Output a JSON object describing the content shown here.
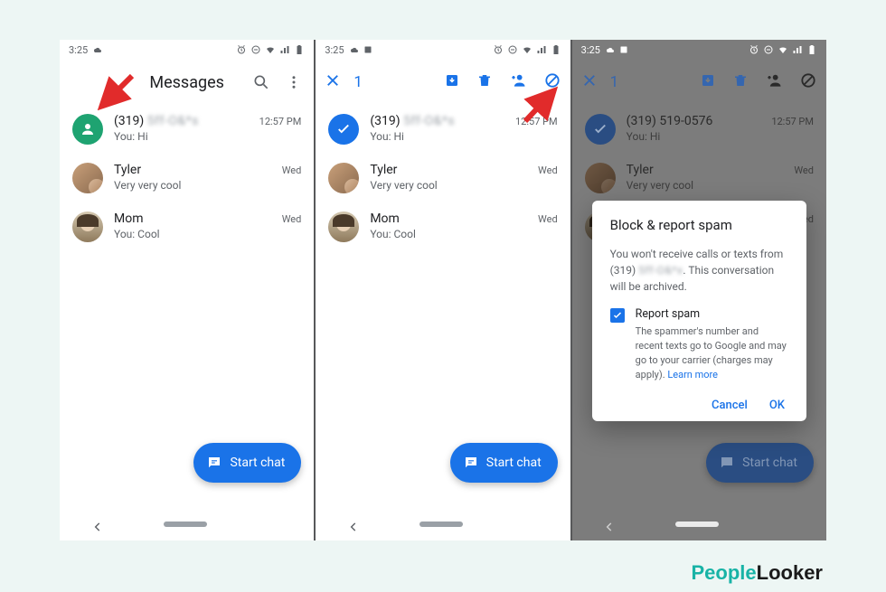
{
  "status": {
    "time": "3:25"
  },
  "screen1": {
    "title": "Messages",
    "conversations": [
      {
        "name_prefix": "(319) ",
        "name_blur": "5ff-O&*s",
        "snippet": "You: Hi",
        "time": "12:57 PM"
      },
      {
        "name": "Tyler",
        "snippet": "Very very cool",
        "time": "Wed"
      },
      {
        "name": "Mom",
        "snippet": "You: Cool",
        "time": "Wed"
      }
    ],
    "fab": "Start chat"
  },
  "screen2": {
    "selected_count": "1",
    "conversations": [
      {
        "name_prefix": "(319) ",
        "name_blur": "5ff-O&*s",
        "snippet": "You: Hi",
        "time": "12:57 PM"
      },
      {
        "name": "Tyler",
        "snippet": "Very very cool",
        "time": "Wed"
      },
      {
        "name": "Mom",
        "snippet": "You: Cool",
        "time": "Wed"
      }
    ],
    "fab": "Start chat"
  },
  "screen3": {
    "selected_count": "1",
    "conversations": [
      {
        "name": "(319) 519-0576",
        "snippet": "You: Hi",
        "time": "12:57 PM"
      },
      {
        "name": "Tyler",
        "snippet": "Very very cool",
        "time": "Wed"
      },
      {
        "name": "Mom",
        "snippet": "You: Cool",
        "time": "Wed"
      }
    ],
    "fab": "Start chat",
    "dialog": {
      "title": "Block & report spam",
      "body_line1": "You won't receive calls or texts from",
      "body_line2_prefix": "(319) ",
      "body_line2_blur": "5ff-O&*x",
      "body_line2_suffix": ". This conversation will be archived.",
      "checkbox_label": "Report spam",
      "checkbox_sub": "The spammer's number and recent texts go to Google and may go to your carrier (charges may apply). ",
      "learn_more": "Learn more",
      "cancel": "Cancel",
      "ok": "OK"
    }
  },
  "logo": {
    "people": "People",
    "looker": "Looker"
  }
}
